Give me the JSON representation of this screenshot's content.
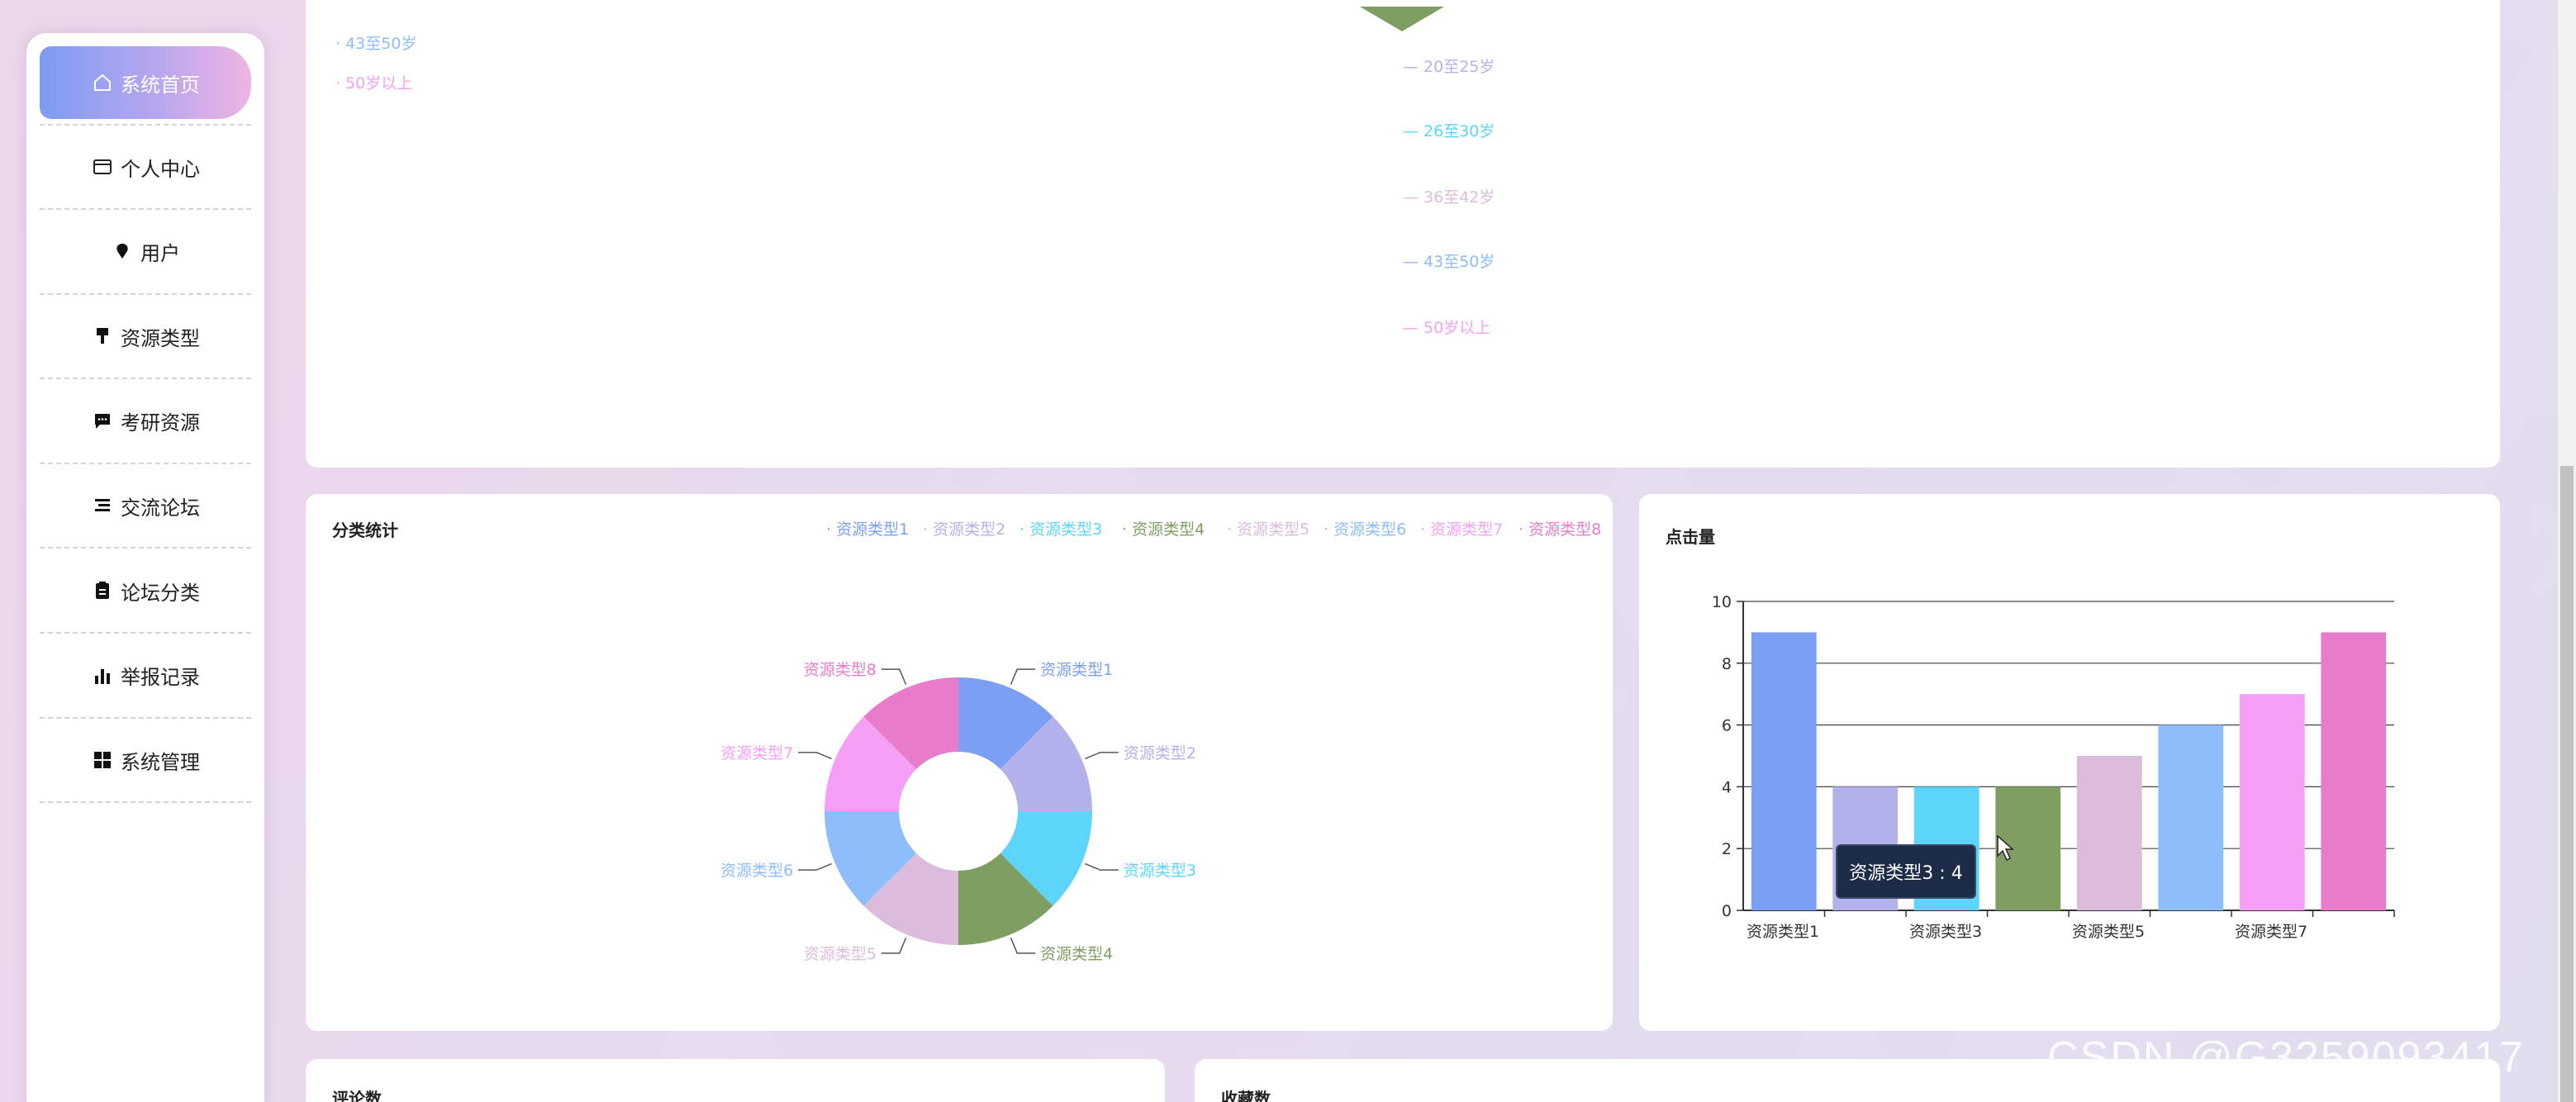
{
  "sidebar": {
    "items": [
      {
        "label": "系统首页",
        "icon": "home-icon"
      },
      {
        "label": "个人中心",
        "icon": "card-icon"
      },
      {
        "label": "用户",
        "icon": "pin-icon"
      },
      {
        "label": "资源类型",
        "icon": "brush-icon"
      },
      {
        "label": "考研资源",
        "icon": "message-icon"
      },
      {
        "label": "交流论坛",
        "icon": "list-icon"
      },
      {
        "label": "论坛分类",
        "icon": "clipboard-icon"
      },
      {
        "label": "举报记录",
        "icon": "bar-chart-icon"
      },
      {
        "label": "系统管理",
        "icon": "grid-icon"
      }
    ]
  },
  "top_card": {
    "left_legend": [
      "43至50岁",
      "50岁以上"
    ],
    "right_legend": [
      "20至25岁",
      "26至30岁",
      "36至42岁",
      "43至50岁",
      "50岁以上"
    ]
  },
  "category_card": {
    "title": "分类统计",
    "legend": [
      "资源类型1",
      "资源类型2",
      "资源类型3",
      "资源类型4",
      "资源类型5",
      "资源类型6",
      "资源类型7",
      "资源类型8"
    ]
  },
  "clicks_card": {
    "title": "点击量",
    "tooltip": "资源类型3 : 4"
  },
  "bottom_cards": {
    "left_title": "评论数",
    "right_title": "收藏数"
  },
  "watermark": "CSDN @G3259093417",
  "colors": {
    "series": [
      "#7a9ff3",
      "#b4b2ea",
      "#5dd5fb",
      "#7f9f62",
      "#dcbcdd",
      "#8ebdfb",
      "#f5a0f6",
      "#e87cca"
    ]
  },
  "chart_data": [
    {
      "type": "pie",
      "title": "分类统计",
      "categories": [
        "资源类型1",
        "资源类型2",
        "资源类型3",
        "资源类型4",
        "资源类型5",
        "资源类型6",
        "资源类型7",
        "资源类型8"
      ],
      "values": [
        1,
        1,
        1,
        1,
        1,
        1,
        1,
        1
      ],
      "legend": "top-right",
      "donut": true
    },
    {
      "type": "bar",
      "title": "点击量",
      "categories": [
        "资源类型1",
        "资源类型2",
        "资源类型3",
        "资源类型4",
        "资源类型5",
        "资源类型6",
        "资源类型7",
        "资源类型8"
      ],
      "tick_labels": [
        "资源类型1",
        "资源类型3",
        "资源类型5",
        "资源类型7"
      ],
      "values": [
        9,
        4,
        4,
        4,
        5,
        6,
        7,
        9
      ],
      "ylim": [
        0,
        10
      ],
      "yticks": [
        0,
        2,
        4,
        6,
        8,
        10
      ],
      "grid": true
    }
  ]
}
